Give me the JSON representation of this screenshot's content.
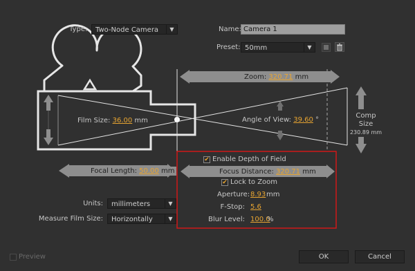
{
  "type": {
    "label": "Type:",
    "value": "Two-Node Camera"
  },
  "name": {
    "label": "Name:",
    "value": "Camera 1"
  },
  "preset": {
    "label": "Preset:",
    "value": "50mm"
  },
  "zoom": {
    "label": "Zoom:",
    "value": "320.71",
    "unit": "mm"
  },
  "film_size": {
    "label": "Film Size:",
    "value": "36.00",
    "unit": "mm"
  },
  "angle_of_view": {
    "label": "Angle of View:",
    "value": "39.60",
    "unit": "°"
  },
  "comp_size": {
    "label": "Comp Size",
    "value": "230.89 mm"
  },
  "focal_length": {
    "label": "Focal Length:",
    "value": "50.00",
    "unit": "mm"
  },
  "enable_dof": {
    "label": "Enable Depth of Field",
    "checked": true
  },
  "focus_distance": {
    "label": "Focus Distance:",
    "value": "320.71",
    "unit": "mm"
  },
  "lock_to_zoom": {
    "label": "Lock to Zoom",
    "checked": true
  },
  "aperture": {
    "label": "Aperture:",
    "value": "8.93",
    "unit": "mm"
  },
  "fstop": {
    "label": "F-Stop:",
    "value": "5.6"
  },
  "blur_level": {
    "label": "Blur Level:",
    "value": "100.0",
    "unit": "%"
  },
  "units": {
    "label": "Units:",
    "value": "millimeters"
  },
  "measure_film_size": {
    "label": "Measure Film Size:",
    "value": "Horizontally"
  },
  "preview": {
    "label": "Preview",
    "checked": false
  },
  "buttons": {
    "ok": "OK",
    "cancel": "Cancel"
  },
  "colors": {
    "accent": "#e8a531",
    "highlight_box": "#d01818",
    "background": "#303030",
    "line": "#e6e6e6"
  }
}
